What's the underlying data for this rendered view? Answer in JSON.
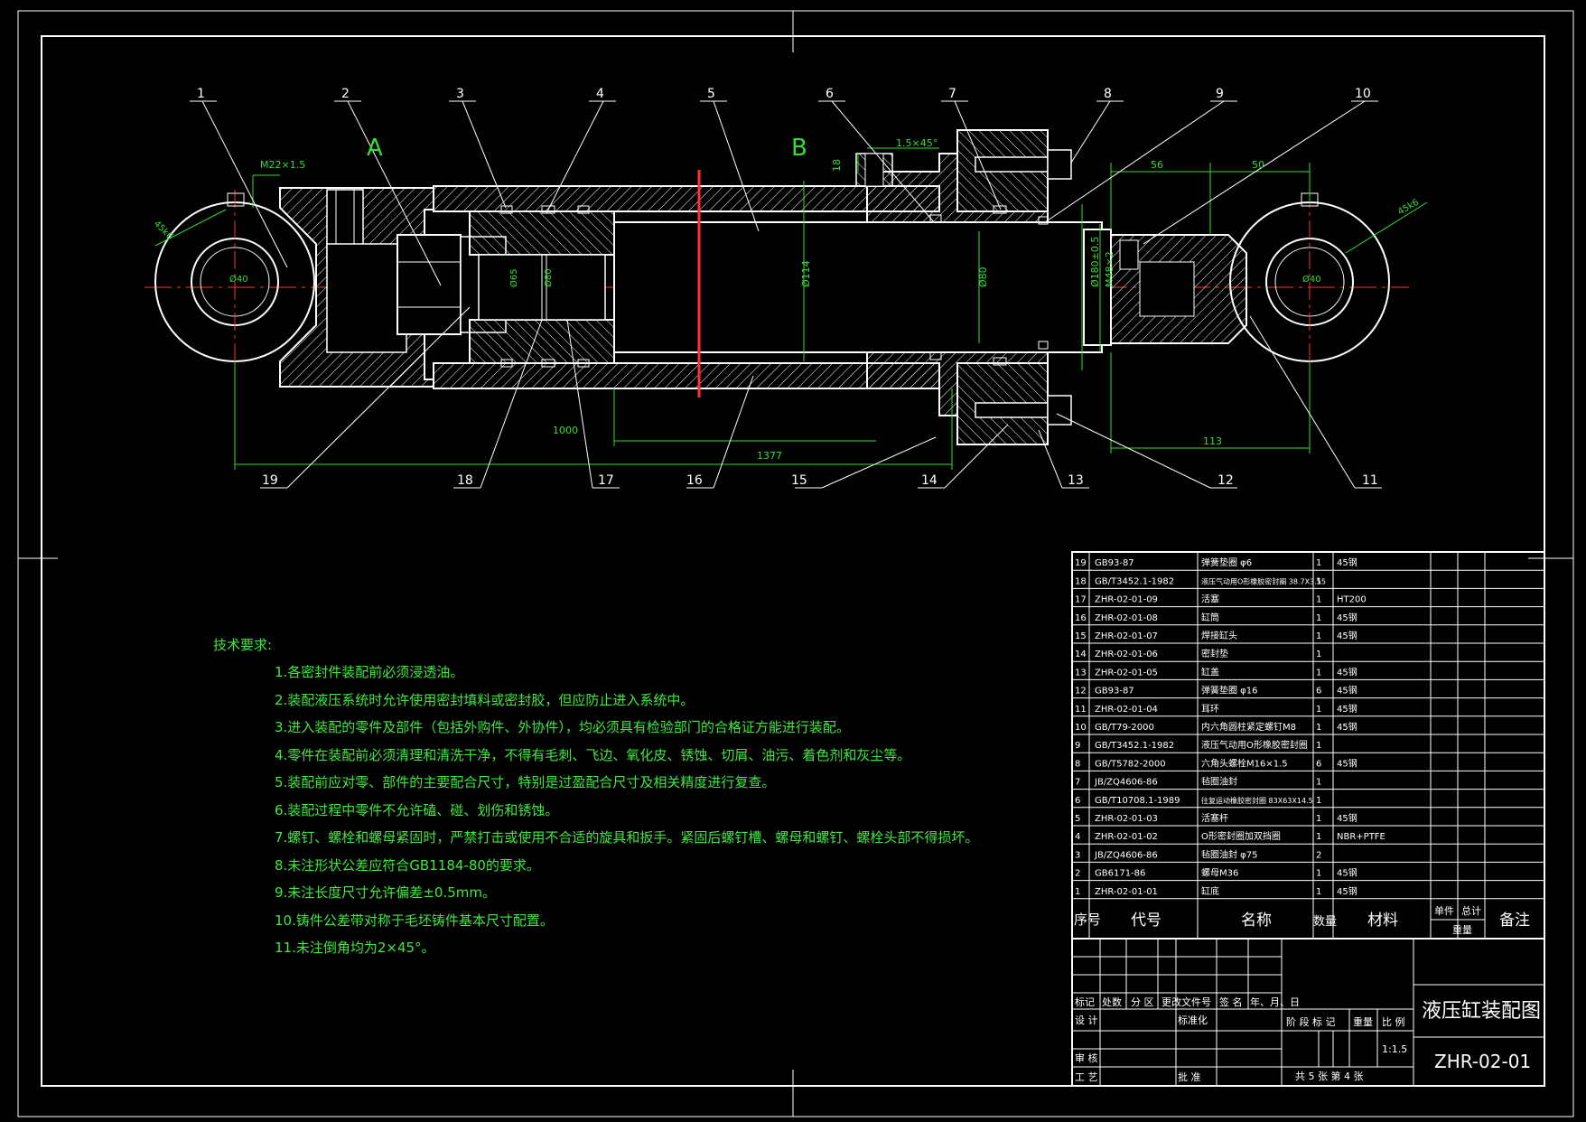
{
  "views": {
    "view_a": "A",
    "view_b": "B"
  },
  "balloons": [
    "1",
    "2",
    "3",
    "4",
    "5",
    "6",
    "7",
    "8",
    "9",
    "10",
    "11",
    "12",
    "13",
    "14",
    "15",
    "16",
    "17",
    "18",
    "19"
  ],
  "dimensions": {
    "thread_m22": "M22×1.5",
    "chamfer": "1.5×45°",
    "d18": "18",
    "d56": "56",
    "d50": "50",
    "d1000": "1000",
    "d1377": "1377",
    "d113": "113",
    "dia114": "Ø114",
    "dia80": "Ø80",
    "dia180": "Ø180±0.5",
    "m48": "M48×2",
    "left_45": "45k6",
    "right_45": "45k6",
    "dia40_left": "Ø40",
    "dia40_right": "Ø40",
    "dia_left_small": "Ø65",
    "dia_left_small2": "Ø80"
  },
  "requirements": {
    "heading": "技术要求:",
    "items": [
      "1.各密封件装配前必须浸透油。",
      "2.装配液压系统时允许使用密封填料或密封胶，但应防止进入系统中。",
      "3.进入装配的零件及部件（包括外购件、外协件），均必须具有检验部门的合格证方能进行装配。",
      "4.零件在装配前必须清理和清洗干净，不得有毛刺、飞边、氧化皮、锈蚀、切屑、油污、着色剂和灰尘等。",
      "5.装配前应对零、部件的主要配合尺寸，特别是过盈配合尺寸及相关精度进行复查。",
      "6.装配过程中零件不允许磕、碰、划伤和锈蚀。",
      "7.螺钉、螺栓和螺母紧固时，严禁打击或使用不合适的旋具和扳手。紧固后螺钉槽、螺母和螺钉、螺栓头部不得损坏。",
      "8.未注形状公差应符合GB1184-80的要求。",
      "9.未注长度尺寸允许偏差±0.5mm。",
      "10.铸件公差带对称于毛坯铸件基本尺寸配置。",
      "11.未注倒角均为2×45°。"
    ]
  },
  "bom": [
    {
      "no": "19",
      "code": "GB93-87",
      "name": "弹簧垫圈 φ6",
      "qty": "1",
      "material": "45钢"
    },
    {
      "no": "18",
      "code": "GB/T3452.1-1982",
      "name": "液压气动用O形橡胶密封圈 38.7X3.55",
      "qty": "1",
      "material": ""
    },
    {
      "no": "17",
      "code": "ZHR-02-01-09",
      "name": "活塞",
      "qty": "1",
      "material": "HT200"
    },
    {
      "no": "16",
      "code": "ZHR-02-01-08",
      "name": "缸筒",
      "qty": "1",
      "material": "45钢"
    },
    {
      "no": "15",
      "code": "ZHR-02-01-07",
      "name": "焊接缸头",
      "qty": "1",
      "material": "45钢"
    },
    {
      "no": "14",
      "code": "ZHR-02-01-06",
      "name": "密封垫",
      "qty": "1",
      "material": ""
    },
    {
      "no": "13",
      "code": "ZHR-02-01-05",
      "name": "缸盖",
      "qty": "1",
      "material": "45钢"
    },
    {
      "no": "12",
      "code": "GB93-87",
      "name": "弹簧垫圈 φ16",
      "qty": "6",
      "material": "45钢"
    },
    {
      "no": "11",
      "code": "ZHR-02-01-04",
      "name": "耳环",
      "qty": "1",
      "material": "45钢"
    },
    {
      "no": "10",
      "code": "GB/T79-2000",
      "name": "内六角圆柱紧定螺钉M8",
      "qty": "1",
      "material": "45钢"
    },
    {
      "no": "9",
      "code": "GB/T3452.1-1982",
      "name": "液压气动用O形橡胶密封圈",
      "qty": "1",
      "material": ""
    },
    {
      "no": "8",
      "code": "GB/T5782-2000",
      "name": "六角头螺栓M16×1.5",
      "qty": "6",
      "material": "45钢"
    },
    {
      "no": "7",
      "code": "JB/ZQ4606-86",
      "name": "毡圈油封",
      "qty": "1",
      "material": ""
    },
    {
      "no": "6",
      "code": "GB/T10708.1-1989",
      "name": "往复运动橡胶密封圈 83X63X14.5",
      "qty": "1",
      "material": ""
    },
    {
      "no": "5",
      "code": "ZHR-02-01-03",
      "name": "活塞杆",
      "qty": "1",
      "material": "45钢"
    },
    {
      "no": "4",
      "code": "ZHR-02-01-02",
      "name": "O形密封圈加双挡圈",
      "qty": "1",
      "material": "NBR+PTFE"
    },
    {
      "no": "3",
      "code": "JB/ZQ4606-86",
      "name": "毡圈油封 φ75",
      "qty": "2",
      "material": ""
    },
    {
      "no": "2",
      "code": "GB6171-86",
      "name": "螺母M36",
      "qty": "1",
      "material": "45钢"
    },
    {
      "no": "1",
      "code": "ZHR-02-01-01",
      "name": "缸底",
      "qty": "1",
      "material": "45钢"
    }
  ],
  "bom_header": {
    "no": "序号",
    "code": "代号",
    "name": "名称",
    "qty": "数量",
    "material": "材料",
    "unit": "单件",
    "total": "总计",
    "weight": "重量",
    "remark": "备注"
  },
  "title_block": {
    "title": "液压缸装配图",
    "drawing_no": "ZHR-02-01",
    "mark": "标记",
    "count": "处数",
    "zone": "分 区",
    "change_doc": "更改文件号",
    "sign": "签 名",
    "date": "年、月、日",
    "design": "设 计",
    "standardize": "标准化",
    "review": "审 核",
    "process": "工 艺",
    "approve": "批 准",
    "stage": "阶 段 标 记",
    "weight": "重量",
    "scale_label": "比 例",
    "scale": "1:1.5",
    "sheets": "共 5  张  第  4 张"
  },
  "colors": {
    "frame": "#ffffff",
    "dim": "#33dd33",
    "center": "#ff3333",
    "hatch": "#ffffff",
    "text_green": "#3fe83f"
  }
}
